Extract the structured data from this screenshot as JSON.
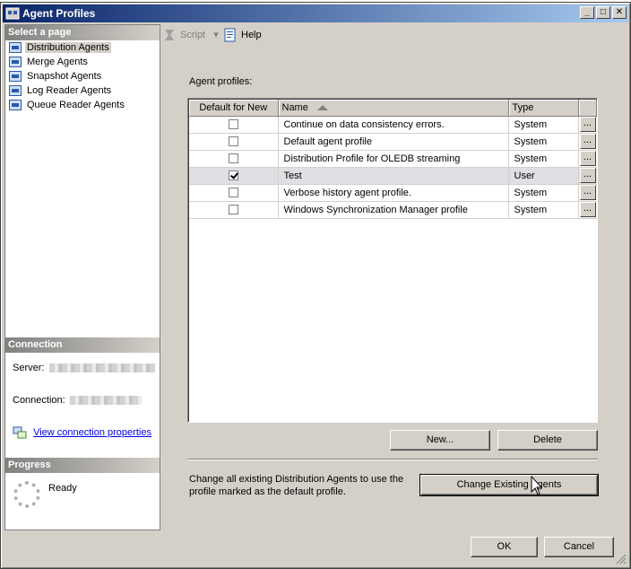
{
  "window": {
    "title": "Agent Profiles",
    "controls": {
      "minimize": "_",
      "maximize": "□",
      "close": "✕"
    }
  },
  "sidebar": {
    "select_page_header": "Select a page",
    "pages": [
      {
        "label": "Distribution Agents",
        "selected": true
      },
      {
        "label": "Merge Agents",
        "selected": false
      },
      {
        "label": "Snapshot Agents",
        "selected": false
      },
      {
        "label": "Log Reader Agents",
        "selected": false
      },
      {
        "label": "Queue Reader Agents",
        "selected": false
      }
    ],
    "connection_header": "Connection",
    "server_label": "Server:",
    "connection_label": "Connection:",
    "view_connection_link": "View connection properties",
    "progress_header": "Progress",
    "progress_status": "Ready"
  },
  "toolbar": {
    "script_label": "Script",
    "help_label": "Help"
  },
  "main": {
    "agent_profiles_label": "Agent profiles:",
    "columns": [
      "Default for New",
      "Name",
      "Type"
    ],
    "rows": [
      {
        "default": false,
        "name": "Continue on data consistency errors.",
        "type": "System",
        "action": "..."
      },
      {
        "default": false,
        "name": "Default agent profile",
        "type": "System",
        "action": "..."
      },
      {
        "default": false,
        "name": "Distribution Profile for OLEDB streaming",
        "type": "System",
        "action": "..."
      },
      {
        "default": true,
        "name": "Test",
        "type": "User",
        "action": "..."
      },
      {
        "default": false,
        "name": "Verbose history agent profile.",
        "type": "System",
        "action": "..."
      },
      {
        "default": false,
        "name": "Windows Synchronization Manager profile",
        "type": "System",
        "action": "..."
      }
    ],
    "new_button": "New...",
    "delete_button": "Delete",
    "change_text": "Change all existing Distribution Agents to use the profile marked as the default profile.",
    "change_button": "Change Existing Agents"
  },
  "footer": {
    "ok_button": "OK",
    "cancel_button": "Cancel"
  }
}
